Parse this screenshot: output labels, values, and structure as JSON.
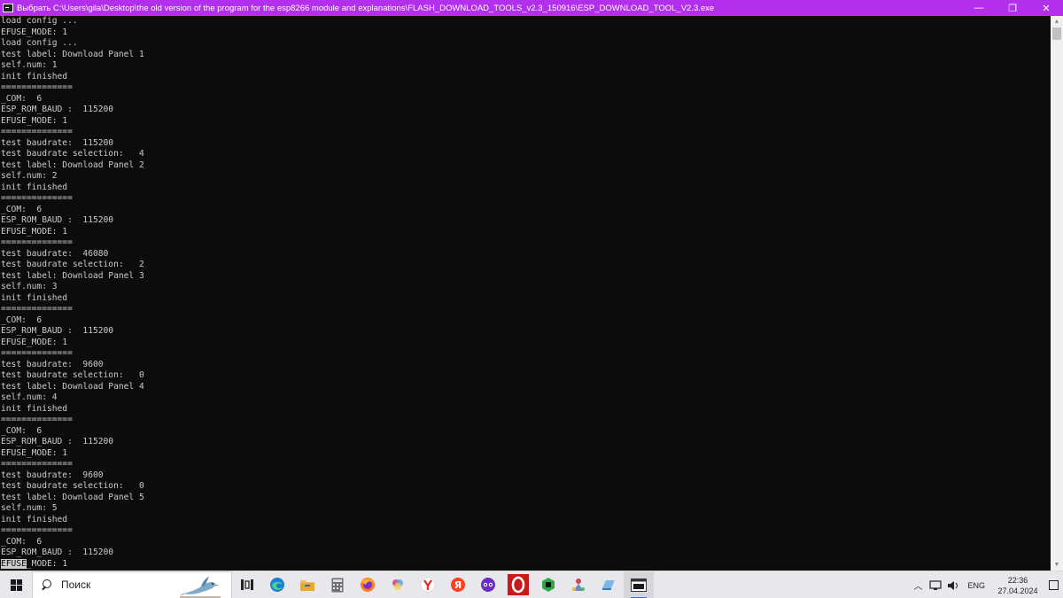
{
  "window": {
    "title": "Выбрать C:\\Users\\gila\\Desktop\\the old version of the program for the esp8266 module and explanations\\FLASH_DOWNLOAD_TOOLS_v2.3_150916\\ESP_DOWNLOAD_TOOL_V2.3.exe",
    "minimize": "—",
    "maximize": "❐",
    "close": "✕",
    "accent": "#b230ec"
  },
  "console": {
    "lines": [
      "load config ...",
      "EFUSE_MODE: 1",
      "load config ...",
      "test label: Download Panel 1",
      "self.num: 1",
      "init finished",
      "==============",
      "_COM:  6",
      "ESP_ROM_BAUD :  115200",
      "EFUSE_MODE: 1",
      "==============",
      "test baudrate:  115200",
      "test baudrate selection:   4",
      "test label: Download Panel 2",
      "self.num: 2",
      "init finished",
      "==============",
      "_COM:  6",
      "ESP_ROM_BAUD :  115200",
      "EFUSE_MODE: 1",
      "==============",
      "test baudrate:  46080",
      "test baudrate selection:   2",
      "test label: Download Panel 3",
      "self.num: 3",
      "init finished",
      "==============",
      "_COM:  6",
      "ESP_ROM_BAUD :  115200",
      "EFUSE_MODE: 1",
      "==============",
      "test baudrate:  9600",
      "test baudrate selection:   0",
      "test label: Download Panel 4",
      "self.num: 4",
      "init finished",
      "==============",
      "_COM:  6",
      "ESP_ROM_BAUD :  115200",
      "EFUSE_MODE: 1",
      "==============",
      "test baudrate:  9600",
      "test baudrate selection:   0",
      "test label: Download Panel 5",
      "self.num: 5",
      "init finished",
      "==============",
      "_COM:  6",
      "ESP_ROM_BAUD :  115200"
    ],
    "last_line_selected": "EFUSE",
    "last_line_rest": "_MODE: 1"
  },
  "taskbar": {
    "search_placeholder": "Поиск",
    "language": "ENG",
    "time": "22:36",
    "date": "27.04.2024"
  }
}
